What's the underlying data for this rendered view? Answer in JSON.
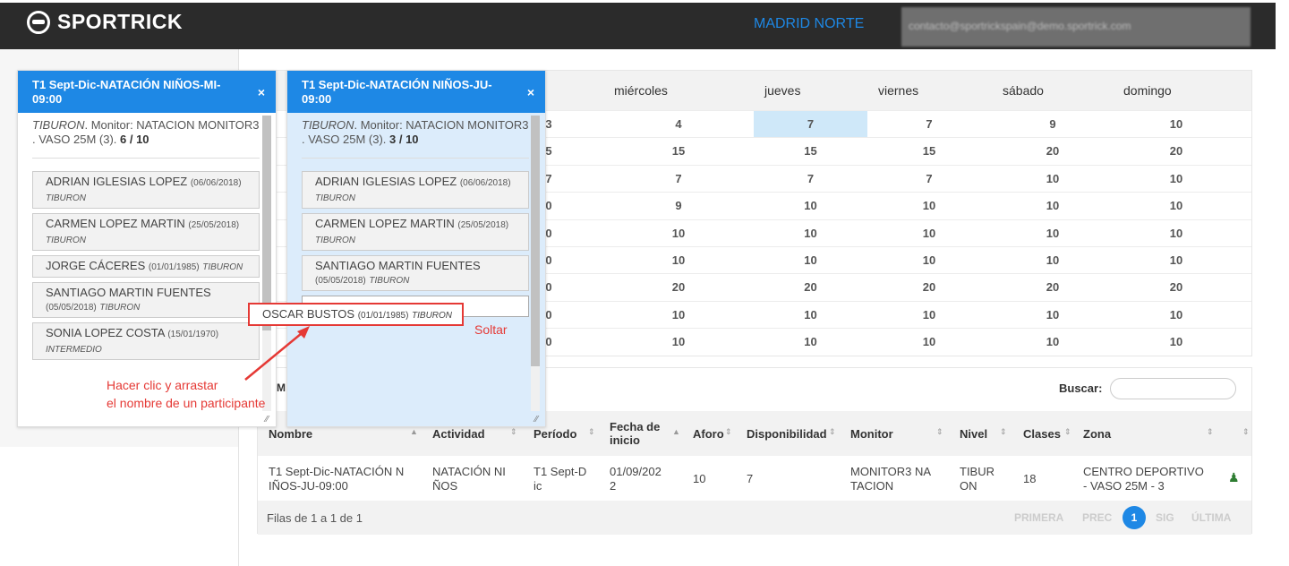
{
  "app": {
    "logo": "SPORTRICK",
    "branch": "MADRID NORTE",
    "user": "contacto@sportrickspain@demo.sportrick.com"
  },
  "calendar": {
    "days": [
      "miércoles",
      "jueves",
      "viernes",
      "sábado",
      "domingo"
    ],
    "rows": [
      [
        "4",
        "7",
        "7",
        "9",
        "10"
      ],
      [
        "15",
        "15",
        "15",
        "20",
        "20"
      ],
      [
        "7",
        "7",
        "7",
        "10",
        "10"
      ],
      [
        "9",
        "10",
        "10",
        "10",
        "10"
      ],
      [
        "10",
        "10",
        "10",
        "10",
        "10"
      ],
      [
        "10",
        "10",
        "10",
        "10",
        "10"
      ],
      [
        "20",
        "20",
        "20",
        "20",
        "20"
      ],
      [
        "10",
        "10",
        "10",
        "10",
        "10"
      ],
      [
        "10",
        "10",
        "10",
        "10",
        "10"
      ]
    ],
    "partial_col_before": [
      "3",
      "5",
      "7",
      "0",
      "0",
      "0",
      "0",
      "0",
      "0"
    ],
    "highlight": {
      "row": 0,
      "col": 1
    }
  },
  "card_left": {
    "title": "T1 Sept-Dic-NATACIÓN NIÑOS-MI-09:00",
    "close": "×",
    "info_level": "TIBURON",
    "info_text": ". Monitor: NATACION MONITOR3 . VASO 25M (3). ",
    "info_count": "6 / 10",
    "participants": [
      {
        "name": "ADRIAN IGLESIAS LOPEZ",
        "date": "(06/06/2018)",
        "level": "TIBURON"
      },
      {
        "name": "CARMEN LOPEZ MARTIN",
        "date": "(25/05/2018)",
        "level": "TIBURON"
      },
      {
        "name": "JORGE CÁCERES",
        "date": "(01/01/1985)",
        "level": "TIBURON"
      },
      {
        "name": "SANTIAGO MARTIN FUENTES",
        "date": "(05/05/2018)",
        "level": "TIBURON"
      },
      {
        "name": "SONIA LOPEZ COSTA",
        "date": "(15/01/1970)",
        "level": "INTERMEDIO"
      }
    ]
  },
  "card_right": {
    "title": "T1 Sept-Dic-NATACIÓN NIÑOS-JU-09:00",
    "close": "×",
    "info_level": "TIBURON",
    "info_text": ". Monitor: NATACION MONITOR3 . VASO 25M (3). ",
    "info_count": "3 / 10",
    "participants": [
      {
        "name": "ADRIAN IGLESIAS LOPEZ",
        "date": "(06/06/2018)",
        "level": "TIBURON"
      },
      {
        "name": "CARMEN LOPEZ MARTIN",
        "date": "(25/05/2018)",
        "level": "TIBURON"
      },
      {
        "name": "SANTIAGO MARTIN FUENTES",
        "date": "(05/05/2018)",
        "level": "TIBURON"
      }
    ]
  },
  "dragging": {
    "name": "OSCAR BUSTOS",
    "date": "(01/01/1985)",
    "level": "TIBURON"
  },
  "annotations": {
    "drop": "Soltar",
    "drag_line1": "Hacer clic y arrastar",
    "drag_line2": "el nombre de un participante"
  },
  "list": {
    "search_label": "Buscar:",
    "search_value": "",
    "columns": [
      "Nombre",
      "Actividad",
      "Período",
      "Fecha de inicio",
      "Aforo",
      "Disponibilidad",
      "Monitor",
      "Nivel",
      "Clases",
      "Zona"
    ],
    "row": [
      "T1 Sept-Dic-NATACIÓN NIÑOS-JU-09:00",
      "NATACIÓN NIÑOS",
      "T1 Sept-Dic",
      "01/09/2022",
      "10",
      "7",
      "MONITOR3 NATACION",
      "TIBURON",
      "18",
      "CENTRO DEPORTIVO - VASO 25M - 3"
    ],
    "row_display": [
      "T1 Sept-Dic-NATACIÓN N",
      "IÑOS-JU-09:00",
      "NATACIÓN NI",
      "ÑOS",
      "T1 Sept-D",
      "ic",
      "01/09/202",
      "2",
      "MONITOR3 NA",
      "TACION",
      "TIBUR",
      "ON",
      "CENTRO DEPORTIVO",
      "- VASO 25M - 3"
    ],
    "footer": "Filas de 1 a 1 de 1",
    "pager": [
      "PRIMERA",
      "PREC",
      "1",
      "SIG",
      "ÚLTIMA"
    ]
  },
  "left_strip": [
    "M"
  ]
}
